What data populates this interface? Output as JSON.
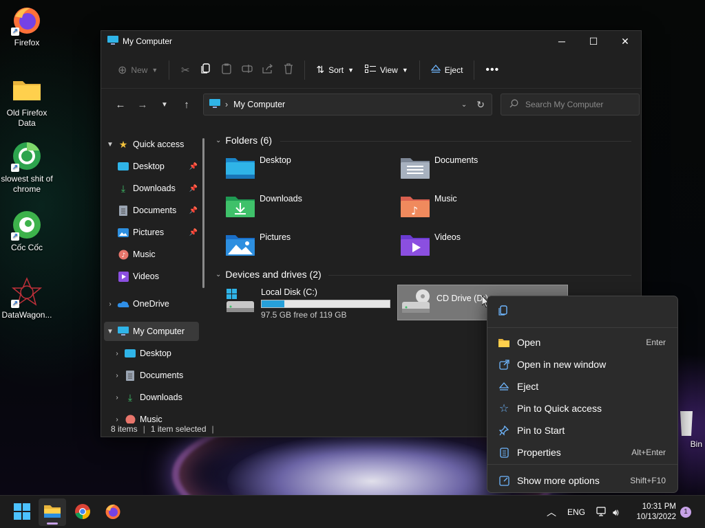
{
  "desktop": {
    "icons": [
      {
        "label": "Firefox"
      },
      {
        "label": "Old Firefox Data"
      },
      {
        "label": "slowest shit of chrome"
      },
      {
        "label": "Cốc Cốc"
      },
      {
        "label": "DataWagon..."
      },
      {
        "label": "Bin"
      }
    ]
  },
  "window": {
    "title": "My Computer",
    "toolbar": {
      "new_label": "New",
      "sort_label": "Sort",
      "view_label": "View",
      "eject_label": "Eject"
    },
    "address": {
      "path": "My Computer"
    },
    "search": {
      "placeholder": "Search My Computer"
    },
    "sidebar": {
      "items": [
        {
          "label": "Quick access"
        },
        {
          "label": "Desktop"
        },
        {
          "label": "Downloads"
        },
        {
          "label": "Documents"
        },
        {
          "label": "Pictures"
        },
        {
          "label": "Music"
        },
        {
          "label": "Videos"
        },
        {
          "label": "OneDrive"
        },
        {
          "label": "My Computer"
        },
        {
          "label": "Desktop"
        },
        {
          "label": "Documents"
        },
        {
          "label": "Downloads"
        },
        {
          "label": "Music"
        }
      ]
    },
    "folders": {
      "heading": "Folders (6)",
      "items": [
        {
          "label": "Desktop"
        },
        {
          "label": "Documents"
        },
        {
          "label": "Downloads"
        },
        {
          "label": "Music"
        },
        {
          "label": "Pictures"
        },
        {
          "label": "Videos"
        }
      ]
    },
    "drives": {
      "heading": "Devices and drives (2)",
      "items": [
        {
          "label": "Local Disk (C:)",
          "free": "97.5 GB free of 119 GB",
          "used_fraction": 0.18
        },
        {
          "label": "CD Drive (D:)"
        }
      ]
    },
    "status": {
      "items_count": "8 items",
      "selected": "1 item selected"
    }
  },
  "context_menu": {
    "items": [
      {
        "label": "Open",
        "shortcut": "Enter"
      },
      {
        "label": "Open in new window",
        "shortcut": ""
      },
      {
        "label": "Eject",
        "shortcut": ""
      },
      {
        "label": "Pin to Quick access",
        "shortcut": ""
      },
      {
        "label": "Pin to Start",
        "shortcut": ""
      },
      {
        "label": "Properties",
        "shortcut": "Alt+Enter"
      },
      {
        "label": "Show more options",
        "shortcut": "Shift+F10"
      }
    ]
  },
  "taskbar": {
    "language": "ENG",
    "time": "10:31 PM",
    "date": "10/13/2022",
    "notifications": "1"
  },
  "colors": {
    "accent": "#26a0da",
    "selection": "#777777"
  }
}
